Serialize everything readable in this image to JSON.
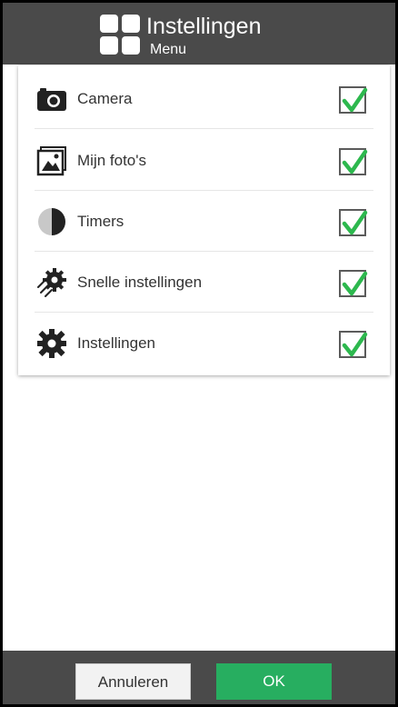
{
  "header": {
    "title": "Instellingen",
    "subtitle": "Menu",
    "icon": "grid-icon"
  },
  "menu_items": [
    {
      "label": "Camera",
      "icon": "camera-icon",
      "checked": true
    },
    {
      "label": "Mijn foto's",
      "icon": "photos-icon",
      "checked": true
    },
    {
      "label": "Timers",
      "icon": "timer-icon",
      "checked": true
    },
    {
      "label": "Snelle instellingen",
      "icon": "quick-settings-icon",
      "checked": true
    },
    {
      "label": "Instellingen",
      "icon": "gear-icon",
      "checked": true
    }
  ],
  "footer": {
    "cancel_label": "Annuleren",
    "ok_label": "OK"
  },
  "colors": {
    "bar": "#4a4a4a",
    "accent": "#27ae60",
    "check": "#2db84e"
  }
}
